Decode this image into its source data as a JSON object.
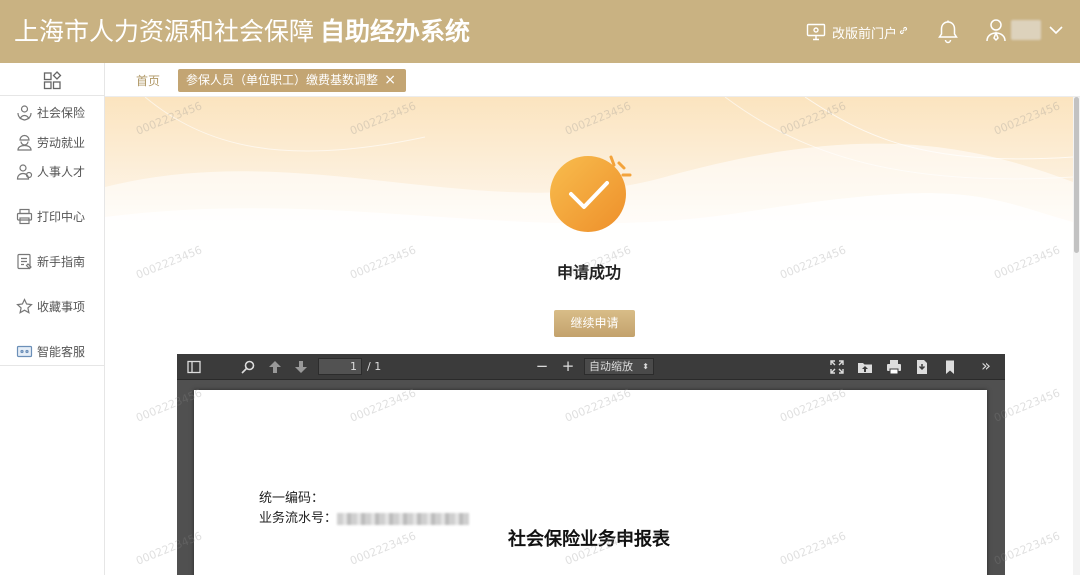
{
  "header": {
    "title_main": "上海市人力资源和社会保障",
    "title_sub": "自助经办系统",
    "portal_label": "改版前门户",
    "portal_link_glyph": "🔗"
  },
  "sidebar": {
    "items": [
      {
        "label": "社会保险",
        "icon": "shield-person-icon"
      },
      {
        "label": "劳动就业",
        "icon": "worker-icon"
      },
      {
        "label": "人事人才",
        "icon": "people-icon"
      },
      {
        "label": "打印中心",
        "icon": "printer-icon"
      },
      {
        "label": "新手指南",
        "icon": "guide-icon"
      },
      {
        "label": "收藏事项",
        "icon": "star-icon"
      },
      {
        "label": "智能客服",
        "icon": "robot-icon"
      }
    ]
  },
  "tabs": {
    "home_label": "首页",
    "active_label": "参保人员（单位职工）缴费基数调整",
    "close_glyph": "×"
  },
  "result": {
    "status_text": "申请成功",
    "continue_label": "继续申请"
  },
  "pdf": {
    "page_current": "1",
    "page_total": "/ 1",
    "zoom_label": "自动缩放",
    "zoom_arrow": "⬍",
    "zoom_out": "−",
    "zoom_in": "+",
    "more_glyph": "»",
    "line1_label": "统一编码：",
    "line2_label": "业务流水号：",
    "doc_title": "社会保险业务申报表"
  },
  "watermark_text": "0002223456",
  "colors": {
    "header_bg": "#c9b282",
    "accent": "#c3a573",
    "check_orange": "#f3a33b"
  }
}
